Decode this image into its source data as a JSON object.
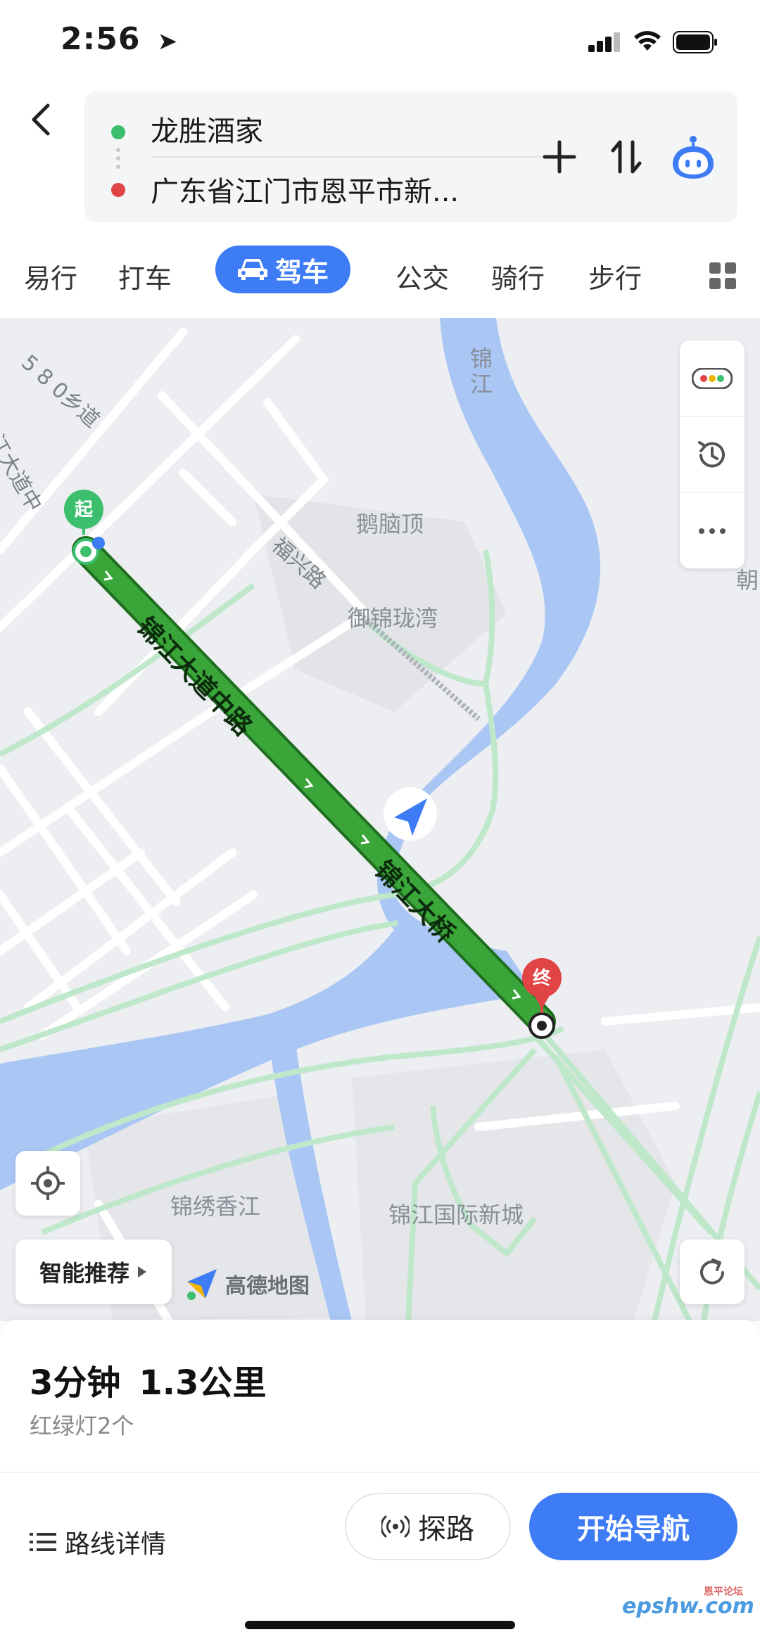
{
  "status_bar": {
    "time": "2:56"
  },
  "route": {
    "start": "龙胜酒家",
    "end": "广东省江门市恩平市新..."
  },
  "modes": [
    "易行",
    "打车",
    "驾车",
    "公交",
    "骑行",
    "步行"
  ],
  "active_mode": "驾车",
  "map": {
    "labels": {
      "road_580": "5 8 0乡道",
      "road_jinjiang_vertical": "锦江大道中",
      "river": "锦江",
      "penaoding": "鹅脑顶",
      "fuxing": "福兴路",
      "yujin": "御锦珑湾",
      "chao": "朝",
      "route_main": "锦江大道中路",
      "route_bridge": "锦江大桥",
      "jinxiu": "锦绣香江",
      "jinjiang_city": "锦江国际新城"
    },
    "start_marker": "起",
    "end_marker": "终",
    "recommend_label": "智能推荐",
    "logo_text": "高德地图"
  },
  "summary": {
    "duration": "3分钟",
    "distance": "1.3公里",
    "lights": "红绿灯2个"
  },
  "actions": {
    "detail": "路线详情",
    "explore": "探路",
    "start_nav": "开始导航"
  },
  "watermark": "epshw.com",
  "watermark_small": "恩平论坛",
  "colors": {
    "accent": "#3d7cf5",
    "route": "#3aa63a",
    "water": "#a9c6f5",
    "start": "#3cbf6c",
    "end": "#e14444"
  }
}
